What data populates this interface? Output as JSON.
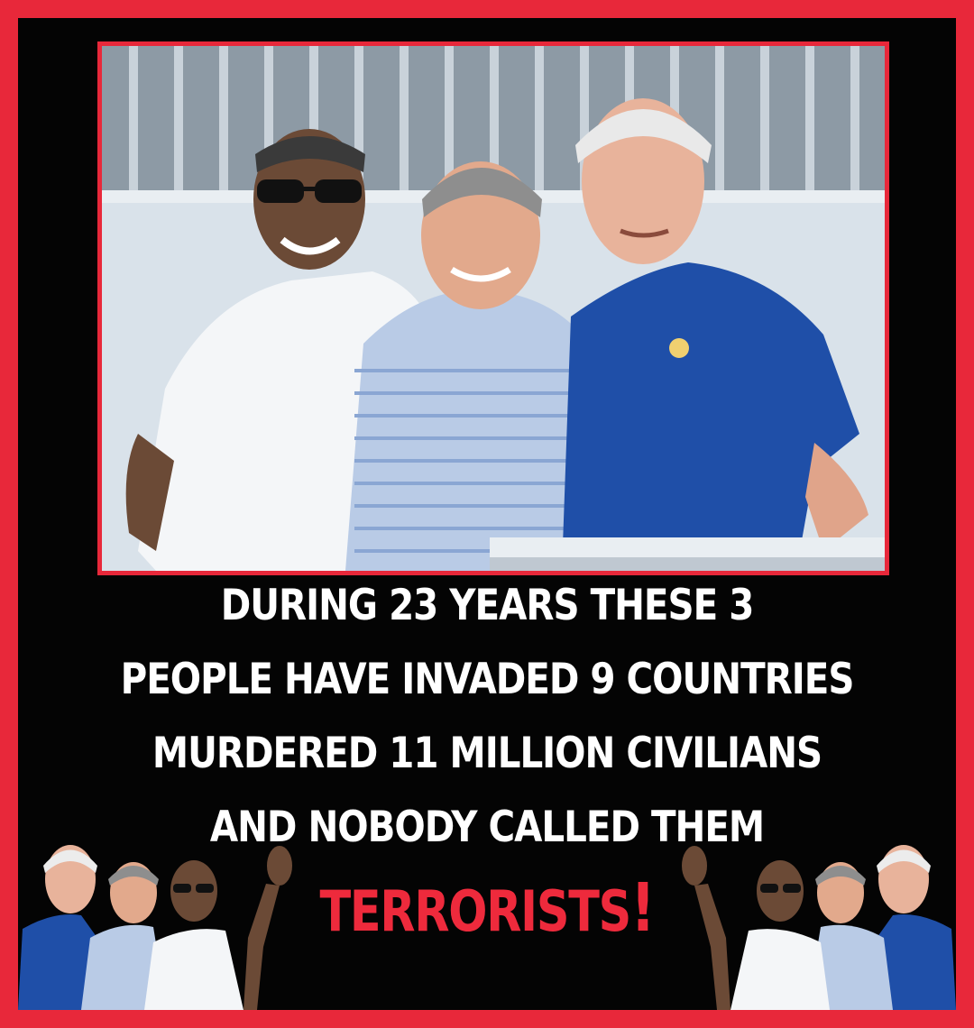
{
  "caption": {
    "line1": "DURING 23 YEARS THESE 3",
    "line2": "PEOPLE HAVE INVADED 9 COUNTRIES",
    "line3": "MURDERED 11 MILLION CIVILIANS",
    "line4": "AND NOBODY CALLED THEM",
    "emphasis": "TERRORISTS",
    "emphasis_mark": "!"
  },
  "colors": {
    "border": "#e8283a",
    "background": "#040404",
    "caption_text": "#ffffff",
    "emphasis_text": "#ee2a3c"
  }
}
